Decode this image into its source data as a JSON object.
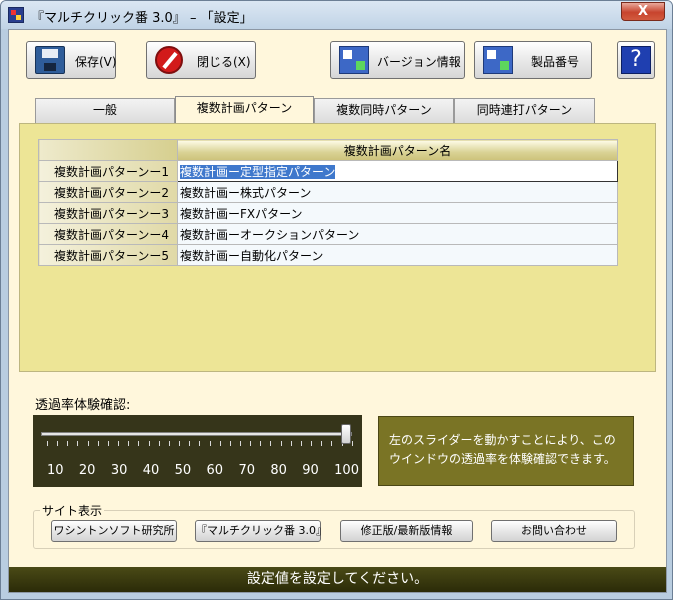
{
  "window": {
    "title": "『マルチクリック番 3.0』 – 「設定」",
    "close_glyph": "X"
  },
  "toolbar": {
    "save_label": "保存(V)",
    "close_label": "閉じる(X)",
    "version_label": "バージョン情報",
    "product_label": "製品番号",
    "help_glyph": "?"
  },
  "tabs": [
    {
      "label": "一般"
    },
    {
      "label": "複数計画パターン"
    },
    {
      "label": "複数同時パターン"
    },
    {
      "label": "同時連打パターン"
    }
  ],
  "grid": {
    "column_header": "複数計画パターン名",
    "rows": [
      {
        "header": "複数計画パターンー1",
        "value": "複数計画ー定型指定パターン"
      },
      {
        "header": "複数計画パターンー2",
        "value": "複数計画ー株式パターン"
      },
      {
        "header": "複数計画パターンー3",
        "value": "複数計画ーFXパターン"
      },
      {
        "header": "複数計画パターンー4",
        "value": "複数計画ーオークションパターン"
      },
      {
        "header": "複数計画パターンー5",
        "value": "複数計画ー自動化パターン"
      }
    ]
  },
  "transparency": {
    "label": "透過率体験確認:",
    "scale": [
      "10",
      "20",
      "30",
      "40",
      "50",
      "60",
      "70",
      "80",
      "90",
      "100"
    ],
    "level_percent": 100,
    "info_line1": "左のスライダーを動かすことにより、この",
    "info_line2": "ウインドウの透過率を体験確認できます。"
  },
  "site": {
    "legend": "サイト表示",
    "buttons": [
      {
        "label": "ワシントンソフト研究所"
      },
      {
        "label": "『マルチクリック番 3.0』"
      },
      {
        "label": "修正版/最新版情報"
      },
      {
        "label": "お問い合わせ"
      }
    ]
  },
  "status": {
    "message": "設定値を設定してください。"
  },
  "colors": {
    "panel": "#ede596",
    "client": "#fff7dc",
    "status": "#2b2b08",
    "selection": "#3f78cc"
  }
}
